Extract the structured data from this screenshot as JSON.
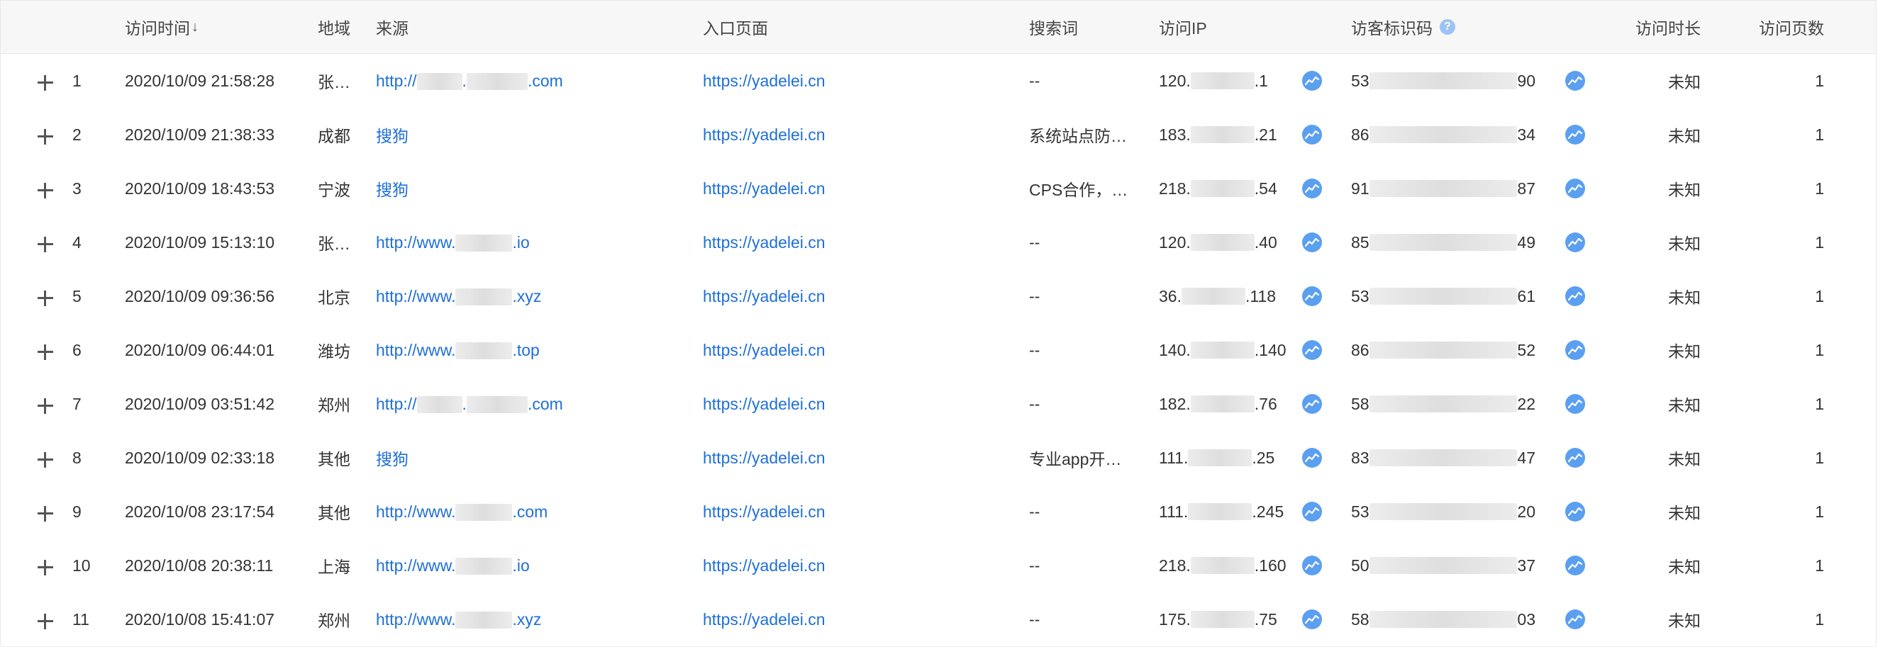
{
  "columns": {
    "time": "访问时间",
    "region": "地域",
    "source": "来源",
    "entry": "入口页面",
    "keyword": "搜索词",
    "ip": "访问IP",
    "visitor_id": "访客标识码",
    "duration": "访问时长",
    "pages": "访问页数"
  },
  "icons": {
    "expand": "plus-icon",
    "sort": "sort-down-icon",
    "help": "help-icon",
    "trend": "trend-icon"
  },
  "help_glyph": "?",
  "sort_glyph": "↓",
  "colors": {
    "link": "#1e6fd9",
    "trend_icon": "#5b9ff0",
    "header_bg": "#f7f7f8"
  },
  "rows": [
    {
      "idx": "1",
      "time": "2020/10/09 21:58:28",
      "region": "张…",
      "source_a": "http://",
      "source_b": ".",
      "source_c": ".com",
      "entry": "https://yadelei.cn",
      "keyword": "--",
      "ip_a": "120.",
      "ip_b": ".1",
      "vid_a": "53",
      "vid_b": "90",
      "duration": "未知",
      "pages": "1"
    },
    {
      "idx": "2",
      "time": "2020/10/09 21:38:33",
      "region": "成都",
      "source_a": "搜狗",
      "source_b": "",
      "source_c": "",
      "entry": "https://yadelei.cn",
      "keyword": "系统站点防…",
      "ip_a": "183.",
      "ip_b": ".21",
      "vid_a": "86",
      "vid_b": "34",
      "duration": "未知",
      "pages": "1"
    },
    {
      "idx": "3",
      "time": "2020/10/09 18:43:53",
      "region": "宁波",
      "source_a": "搜狗",
      "source_b": "",
      "source_c": "",
      "entry": "https://yadelei.cn",
      "keyword": "CPS合作，…",
      "ip_a": "218.",
      "ip_b": ".54",
      "vid_a": "91",
      "vid_b": "87",
      "duration": "未知",
      "pages": "1"
    },
    {
      "idx": "4",
      "time": "2020/10/09 15:13:10",
      "region": "张…",
      "source_a": "http://www.",
      "source_b": "",
      "source_c": ".io",
      "entry": "https://yadelei.cn",
      "keyword": "--",
      "ip_a": "120.",
      "ip_b": ".40",
      "vid_a": "85",
      "vid_b": "49",
      "duration": "未知",
      "pages": "1"
    },
    {
      "idx": "5",
      "time": "2020/10/09 09:36:56",
      "region": "北京",
      "source_a": "http://www.",
      "source_b": "",
      "source_c": ".xyz",
      "entry": "https://yadelei.cn",
      "keyword": "--",
      "ip_a": "36.",
      "ip_b": ".118",
      "vid_a": "53",
      "vid_b": "61",
      "duration": "未知",
      "pages": "1"
    },
    {
      "idx": "6",
      "time": "2020/10/09 06:44:01",
      "region": "潍坊",
      "source_a": "http://www.",
      "source_b": "",
      "source_c": ".top",
      "entry": "https://yadelei.cn",
      "keyword": "--",
      "ip_a": "140.",
      "ip_b": ".140",
      "vid_a": "86",
      "vid_b": "52",
      "duration": "未知",
      "pages": "1"
    },
    {
      "idx": "7",
      "time": "2020/10/09 03:51:42",
      "region": "郑州",
      "source_a": "http://",
      "source_b": ".",
      "source_c": ".com",
      "entry": "https://yadelei.cn",
      "keyword": "--",
      "ip_a": "182.",
      "ip_b": ".76",
      "vid_a": "58",
      "vid_b": "22",
      "duration": "未知",
      "pages": "1"
    },
    {
      "idx": "8",
      "time": "2020/10/09 02:33:18",
      "region": "其他",
      "source_a": "搜狗",
      "source_b": "",
      "source_c": "",
      "entry": "https://yadelei.cn",
      "keyword": "专业app开…",
      "ip_a": "111.",
      "ip_b": ".25",
      "vid_a": "83",
      "vid_b": "47",
      "duration": "未知",
      "pages": "1"
    },
    {
      "idx": "9",
      "time": "2020/10/08 23:17:54",
      "region": "其他",
      "source_a": "http://www.",
      "source_b": "",
      "source_c": ".com",
      "entry": "https://yadelei.cn",
      "keyword": "--",
      "ip_a": "111.",
      "ip_b": ".245",
      "vid_a": "53",
      "vid_b": "20",
      "duration": "未知",
      "pages": "1"
    },
    {
      "idx": "10",
      "time": "2020/10/08 20:38:11",
      "region": "上海",
      "source_a": "http://www.",
      "source_b": "",
      "source_c": ".io",
      "entry": "https://yadelei.cn",
      "keyword": "--",
      "ip_a": "218.",
      "ip_b": ".160",
      "vid_a": "50",
      "vid_b": "37",
      "duration": "未知",
      "pages": "1"
    },
    {
      "idx": "11",
      "time": "2020/10/08 15:41:07",
      "region": "郑州",
      "source_a": "http://www.",
      "source_b": "",
      "source_c": ".xyz",
      "entry": "https://yadelei.cn",
      "keyword": "--",
      "ip_a": "175.",
      "ip_b": ".75",
      "vid_a": "58",
      "vid_b": "03",
      "duration": "未知",
      "pages": "1"
    }
  ]
}
